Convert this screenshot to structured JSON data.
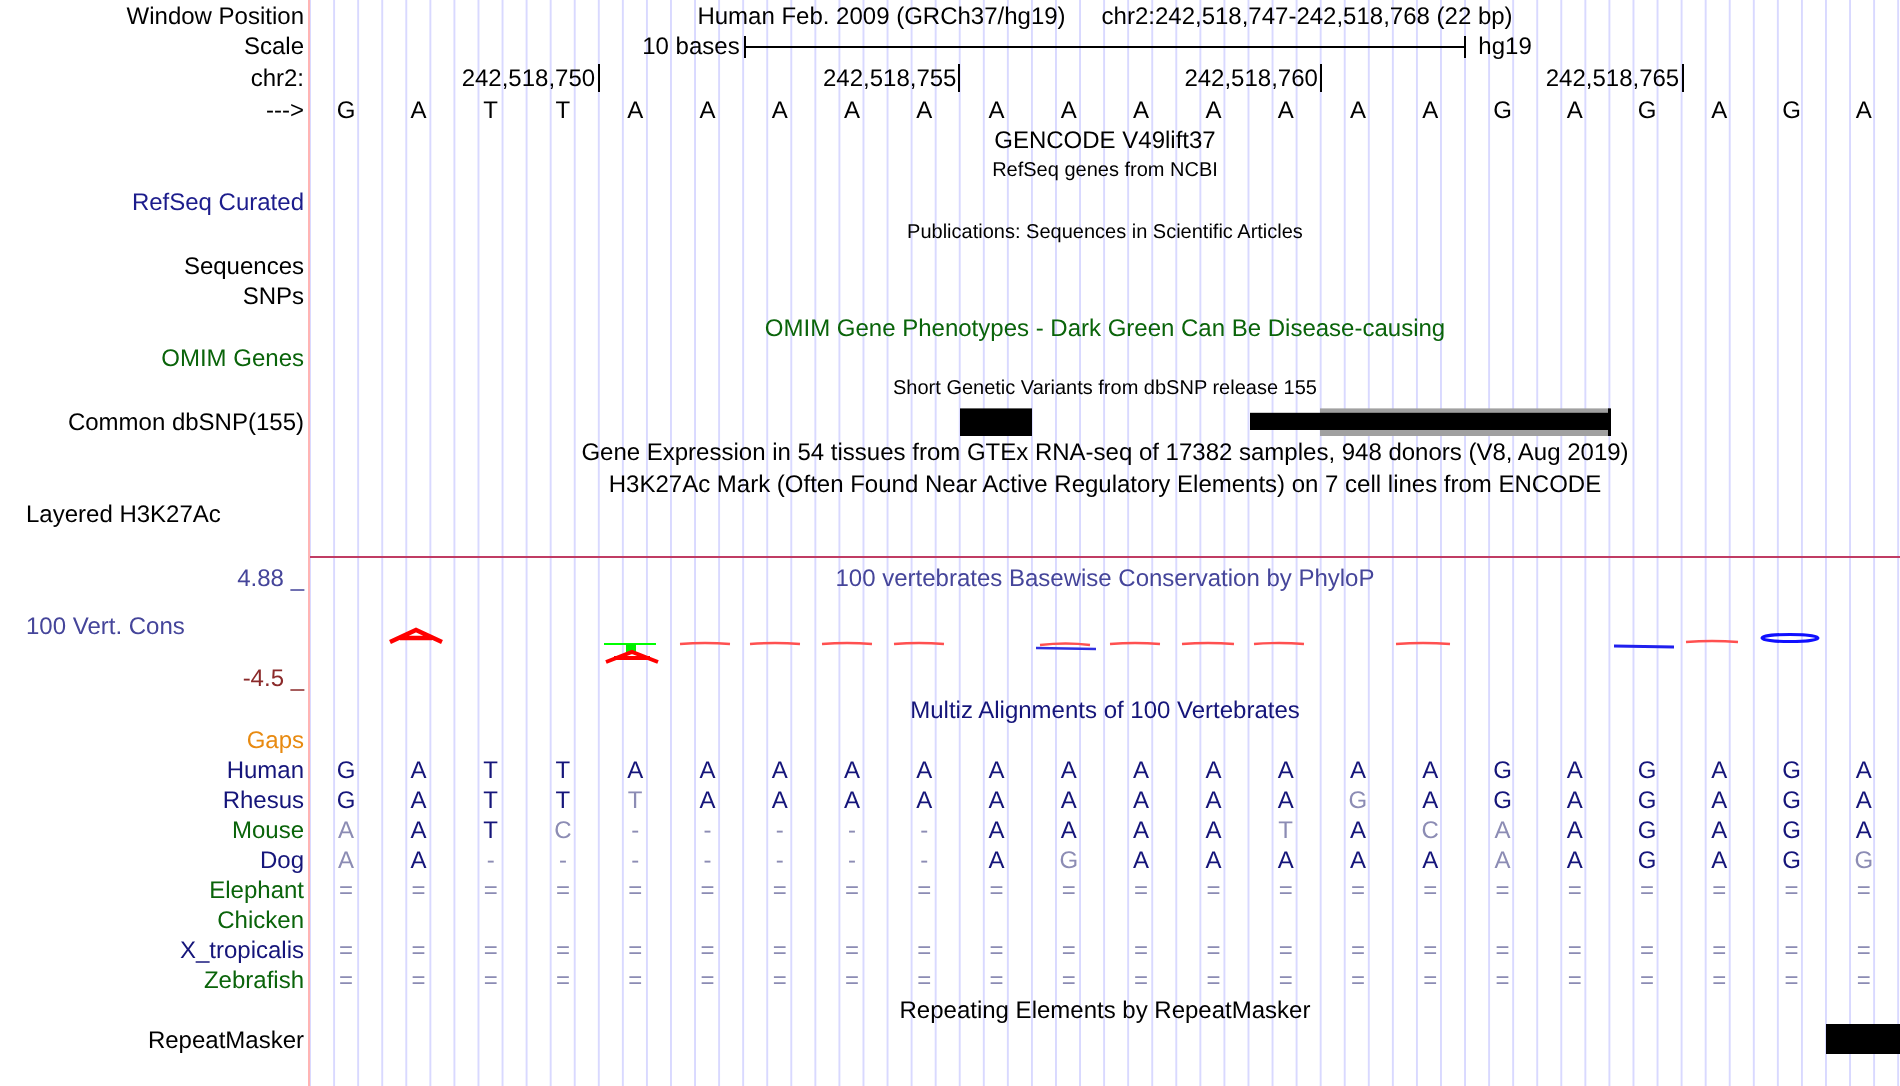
{
  "position_line": {
    "label": "Window Position",
    "assembly": "Human Feb. 2009 (GRCh37/hg19)",
    "position": "chr2:242,518,747-242,518,768 (22 bp)"
  },
  "scale": {
    "label": "Scale",
    "span": "10 bases",
    "assembly": "hg19"
  },
  "ruler": {
    "label": "chr2:",
    "ticks": [
      "242,518,750",
      "242,518,755",
      "242,518,760",
      "242,518,765"
    ]
  },
  "sequence": {
    "label": "--->",
    "bases": [
      "G",
      "A",
      "T",
      "T",
      "A",
      "A",
      "A",
      "A",
      "A",
      "A",
      "A",
      "A",
      "A",
      "A",
      "A",
      "A",
      "G",
      "A",
      "G",
      "A",
      "G",
      "A"
    ]
  },
  "tracks": [
    {
      "kind": "title",
      "text": "GENCODE V49lift37",
      "color": "#000000"
    },
    {
      "kind": "caption",
      "text": "RefSeq genes from NCBI",
      "color": "#000000"
    },
    {
      "kind": "label",
      "label": "RefSeq Curated",
      "color": "#1c1c8c"
    },
    {
      "kind": "caption",
      "text": "Publications: Sequences in Scientific Articles",
      "color": "#000000"
    },
    {
      "kind": "label",
      "label": "Sequences",
      "color": "#000000"
    },
    {
      "kind": "label",
      "label": "SNPs",
      "color": "#000000"
    },
    {
      "kind": "title",
      "text": "OMIM Gene Phenotypes - Dark Green Can Be Disease-causing",
      "color": "#0a640a"
    },
    {
      "kind": "label",
      "label": "OMIM Genes",
      "color": "#0a640a"
    },
    {
      "kind": "caption",
      "text": "Short Genetic Variants from dbSNP release 155",
      "color": "#000000"
    },
    {
      "kind": "snp",
      "label": "Common dbSNP(155)",
      "color": "#000000"
    },
    {
      "kind": "title",
      "text": "Gene Expression in 54 tissues from GTEx RNA-seq of 17382 samples, 948 donors (V8, Aug 2019)",
      "color": "#000000"
    },
    {
      "kind": "title",
      "text": "H3K27Ac Mark (Often Found Near Active Regulatory Elements) on 7 cell lines from ENCODE",
      "color": "#000000"
    },
    {
      "kind": "layered",
      "label": "Layered H3K27Ac",
      "color": "#000000"
    }
  ],
  "conservation": {
    "max": "4.88 _",
    "label": "100 Vert. Cons",
    "min": "-4.5 _",
    "title": "100 vertebrates Basewise Conservation by PhyloP"
  },
  "alignment": {
    "title": "Multiz Alignments of 100 Vertebrates",
    "gaps_label": "Gaps",
    "species": [
      {
        "name": "Human",
        "color": "#15157a",
        "bases": [
          {
            "b": "G",
            "faded": false
          },
          {
            "b": "A",
            "faded": false
          },
          {
            "b": "T",
            "faded": false
          },
          {
            "b": "T",
            "faded": false
          },
          {
            "b": "A",
            "faded": false
          },
          {
            "b": "A",
            "faded": false
          },
          {
            "b": "A",
            "faded": false
          },
          {
            "b": "A",
            "faded": false
          },
          {
            "b": "A",
            "faded": false
          },
          {
            "b": "A",
            "faded": false
          },
          {
            "b": "A",
            "faded": false
          },
          {
            "b": "A",
            "faded": false
          },
          {
            "b": "A",
            "faded": false
          },
          {
            "b": "A",
            "faded": false
          },
          {
            "b": "A",
            "faded": false
          },
          {
            "b": "A",
            "faded": false
          },
          {
            "b": "G",
            "faded": false
          },
          {
            "b": "A",
            "faded": false
          },
          {
            "b": "G",
            "faded": false
          },
          {
            "b": "A",
            "faded": false
          },
          {
            "b": "G",
            "faded": false
          },
          {
            "b": "A",
            "faded": false
          }
        ]
      },
      {
        "name": "Rhesus",
        "color": "#15157a",
        "bases": [
          {
            "b": "G",
            "faded": false
          },
          {
            "b": "A",
            "faded": false
          },
          {
            "b": "T",
            "faded": false
          },
          {
            "b": "T",
            "faded": false
          },
          {
            "b": "T",
            "faded": true
          },
          {
            "b": "A",
            "faded": false
          },
          {
            "b": "A",
            "faded": false
          },
          {
            "b": "A",
            "faded": false
          },
          {
            "b": "A",
            "faded": false
          },
          {
            "b": "A",
            "faded": false
          },
          {
            "b": "A",
            "faded": false
          },
          {
            "b": "A",
            "faded": false
          },
          {
            "b": "A",
            "faded": false
          },
          {
            "b": "A",
            "faded": false
          },
          {
            "b": "G",
            "faded": true
          },
          {
            "b": "A",
            "faded": false
          },
          {
            "b": "G",
            "faded": false
          },
          {
            "b": "A",
            "faded": false
          },
          {
            "b": "G",
            "faded": false
          },
          {
            "b": "A",
            "faded": false
          },
          {
            "b": "G",
            "faded": false
          },
          {
            "b": "A",
            "faded": false
          }
        ]
      },
      {
        "name": "Mouse",
        "color": "#0a640a",
        "bases": [
          {
            "b": "A",
            "faded": true
          },
          {
            "b": "A",
            "faded": false
          },
          {
            "b": "T",
            "faded": false
          },
          {
            "b": "C",
            "faded": true
          },
          {
            "b": "-",
            "faded": true
          },
          {
            "b": "-",
            "faded": true
          },
          {
            "b": "-",
            "faded": true
          },
          {
            "b": "-",
            "faded": true
          },
          {
            "b": "-",
            "faded": true
          },
          {
            "b": "A",
            "faded": false
          },
          {
            "b": "A",
            "faded": false
          },
          {
            "b": "A",
            "faded": false
          },
          {
            "b": "A",
            "faded": false
          },
          {
            "b": "T",
            "faded": true
          },
          {
            "b": "A",
            "faded": false
          },
          {
            "b": "C",
            "faded": true
          },
          {
            "b": "A",
            "faded": true
          },
          {
            "b": "A",
            "faded": false
          },
          {
            "b": "G",
            "faded": false
          },
          {
            "b": "A",
            "faded": false
          },
          {
            "b": "G",
            "faded": false
          },
          {
            "b": "A",
            "faded": false
          }
        ]
      },
      {
        "name": "Dog",
        "color": "#15157a",
        "bases": [
          {
            "b": "A",
            "faded": true
          },
          {
            "b": "A",
            "faded": false
          },
          {
            "b": "-",
            "faded": true
          },
          {
            "b": "-",
            "faded": true
          },
          {
            "b": "-",
            "faded": true
          },
          {
            "b": "-",
            "faded": true
          },
          {
            "b": "-",
            "faded": true
          },
          {
            "b": "-",
            "faded": true
          },
          {
            "b": "-",
            "faded": true
          },
          {
            "b": "A",
            "faded": false
          },
          {
            "b": "G",
            "faded": true
          },
          {
            "b": "A",
            "faded": false
          },
          {
            "b": "A",
            "faded": false
          },
          {
            "b": "A",
            "faded": false
          },
          {
            "b": "A",
            "faded": false
          },
          {
            "b": "A",
            "faded": false
          },
          {
            "b": "A",
            "faded": true
          },
          {
            "b": "A",
            "faded": false
          },
          {
            "b": "G",
            "faded": false
          },
          {
            "b": "A",
            "faded": false
          },
          {
            "b": "G",
            "faded": false
          },
          {
            "b": "G",
            "faded": true
          }
        ]
      },
      {
        "name": "Elephant",
        "color": "#0a640a",
        "bases": [
          {
            "b": "=",
            "faded": true
          },
          {
            "b": "=",
            "faded": true
          },
          {
            "b": "=",
            "faded": true
          },
          {
            "b": "=",
            "faded": true
          },
          {
            "b": "=",
            "faded": true
          },
          {
            "b": "=",
            "faded": true
          },
          {
            "b": "=",
            "faded": true
          },
          {
            "b": "=",
            "faded": true
          },
          {
            "b": "=",
            "faded": true
          },
          {
            "b": "=",
            "faded": true
          },
          {
            "b": "=",
            "faded": true
          },
          {
            "b": "=",
            "faded": true
          },
          {
            "b": "=",
            "faded": true
          },
          {
            "b": "=",
            "faded": true
          },
          {
            "b": "=",
            "faded": true
          },
          {
            "b": "=",
            "faded": true
          },
          {
            "b": "=",
            "faded": true
          },
          {
            "b": "=",
            "faded": true
          },
          {
            "b": "=",
            "faded": true
          },
          {
            "b": "=",
            "faded": true
          },
          {
            "b": "=",
            "faded": true
          },
          {
            "b": "=",
            "faded": true
          }
        ]
      },
      {
        "name": "Chicken",
        "color": "#0a640a"
      },
      {
        "name": "X_tropicalis",
        "color": "#15157a",
        "bases": [
          {
            "b": "=",
            "faded": true
          },
          {
            "b": "=",
            "faded": true
          },
          {
            "b": "=",
            "faded": true
          },
          {
            "b": "=",
            "faded": true
          },
          {
            "b": "=",
            "faded": true
          },
          {
            "b": "=",
            "faded": true
          },
          {
            "b": "=",
            "faded": true
          },
          {
            "b": "=",
            "faded": true
          },
          {
            "b": "=",
            "faded": true
          },
          {
            "b": "=",
            "faded": true
          },
          {
            "b": "=",
            "faded": true
          },
          {
            "b": "=",
            "faded": true
          },
          {
            "b": "=",
            "faded": true
          },
          {
            "b": "=",
            "faded": true
          },
          {
            "b": "=",
            "faded": true
          },
          {
            "b": "=",
            "faded": true
          },
          {
            "b": "=",
            "faded": true
          },
          {
            "b": "=",
            "faded": true
          },
          {
            "b": "=",
            "faded": true
          },
          {
            "b": "=",
            "faded": true
          },
          {
            "b": "=",
            "faded": true
          },
          {
            "b": "=",
            "faded": true
          }
        ]
      },
      {
        "name": "Zebrafish",
        "color": "#0a640a",
        "bases": [
          {
            "b": "=",
            "faded": true
          },
          {
            "b": "=",
            "faded": true
          },
          {
            "b": "=",
            "faded": true
          },
          {
            "b": "=",
            "faded": true
          },
          {
            "b": "=",
            "faded": true
          },
          {
            "b": "=",
            "faded": true
          },
          {
            "b": "=",
            "faded": true
          },
          {
            "b": "=",
            "faded": true
          },
          {
            "b": "=",
            "faded": true
          },
          {
            "b": "=",
            "faded": true
          },
          {
            "b": "=",
            "faded": true
          },
          {
            "b": "=",
            "faded": true
          },
          {
            "b": "=",
            "faded": true
          },
          {
            "b": "=",
            "faded": true
          },
          {
            "b": "=",
            "faded": true
          },
          {
            "b": "=",
            "faded": true
          },
          {
            "b": "=",
            "faded": true
          },
          {
            "b": "=",
            "faded": true
          },
          {
            "b": "=",
            "faded": true
          },
          {
            "b": "=",
            "faded": true
          },
          {
            "b": "=",
            "faded": true
          },
          {
            "b": "=",
            "faded": true
          }
        ]
      }
    ]
  },
  "repeats": {
    "title": "Repeating Elements by RepeatMasker",
    "label": "RepeatMasker"
  }
}
